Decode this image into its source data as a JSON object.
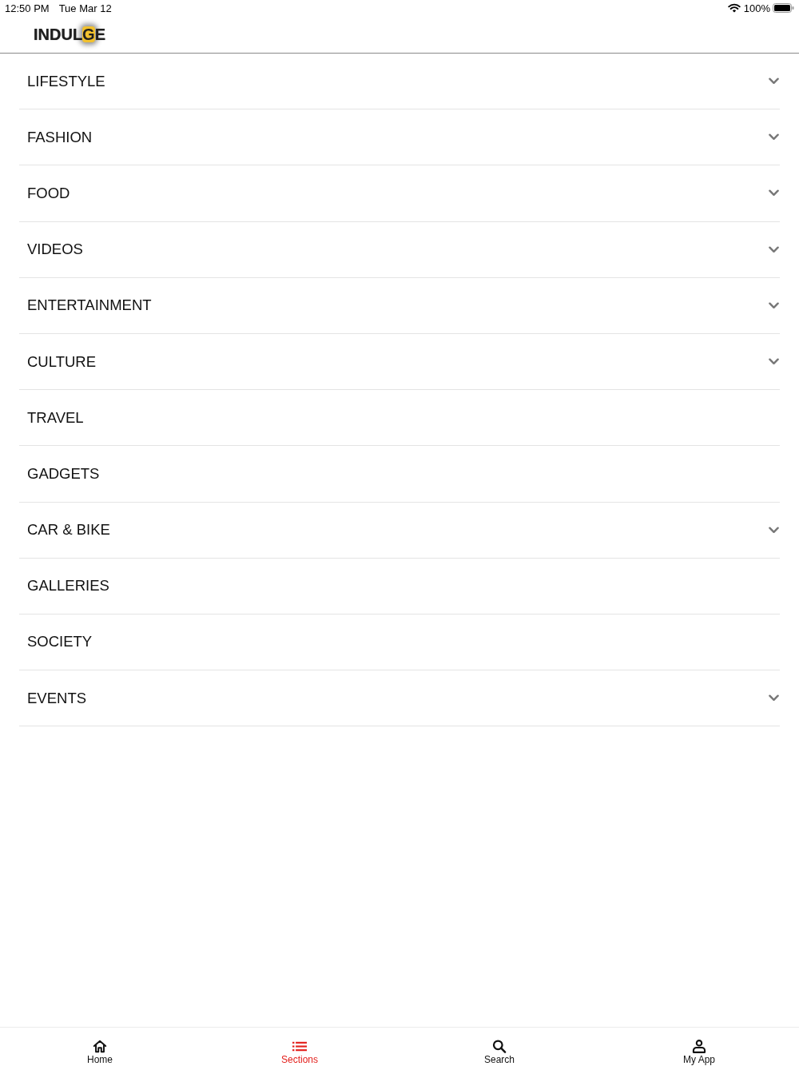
{
  "status_bar": {
    "time": "12:50 PM",
    "date": "Tue Mar 12",
    "battery": "100%"
  },
  "header": {
    "logo": {
      "text_start": "INDUL",
      "highlight": "G",
      "text_end": "E"
    }
  },
  "menu": {
    "items": [
      {
        "label": "LIFESTYLE",
        "has_submenu": true
      },
      {
        "label": "FASHION",
        "has_submenu": true
      },
      {
        "label": "FOOD",
        "has_submenu": true
      },
      {
        "label": "VIDEOS",
        "has_submenu": true
      },
      {
        "label": "ENTERTAINMENT",
        "has_submenu": true
      },
      {
        "label": "CULTURE",
        "has_submenu": true
      },
      {
        "label": "TRAVEL",
        "has_submenu": false
      },
      {
        "label": "GADGETS",
        "has_submenu": false
      },
      {
        "label": "CAR & BIKE",
        "has_submenu": true
      },
      {
        "label": "GALLERIES",
        "has_submenu": false
      },
      {
        "label": "SOCIETY",
        "has_submenu": false
      },
      {
        "label": "EVENTS",
        "has_submenu": true
      }
    ]
  },
  "tab_bar": {
    "tabs": [
      {
        "kind": "home",
        "label": "Home",
        "selected": false
      },
      {
        "kind": "sections",
        "label": "Sections",
        "selected": true
      },
      {
        "kind": "search",
        "label": "Search",
        "selected": false
      },
      {
        "kind": "account",
        "label": "My App",
        "selected": false
      }
    ]
  }
}
